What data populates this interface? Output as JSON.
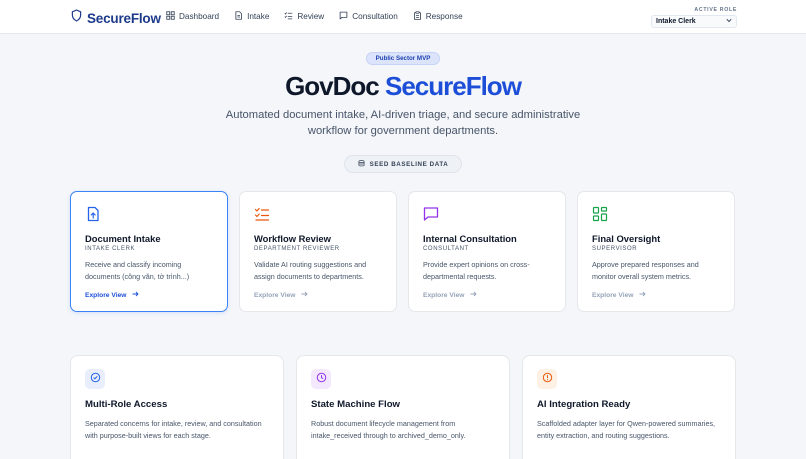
{
  "app": {
    "brand": "SecureFlow"
  },
  "nav": {
    "items": [
      {
        "label": "Dashboard",
        "icon": "dashboard-icon"
      },
      {
        "label": "Intake",
        "icon": "file-icon"
      },
      {
        "label": "Review",
        "icon": "list-check-icon"
      },
      {
        "label": "Consultation",
        "icon": "chat-icon"
      },
      {
        "label": "Response",
        "icon": "clipboard-icon"
      }
    ]
  },
  "role": {
    "caption": "ACTIVE ROLE",
    "selected": "Intake Clerk"
  },
  "hero": {
    "pill": "Public Sector MVP",
    "title_part1": "GovDoc",
    "title_part2": "SecureFlow",
    "subtitle": "Automated document intake, AI-driven triage, and secure administrative workflow for government departments.",
    "seed_button": "SEED BASELINE DATA"
  },
  "role_cards": [
    {
      "title": "Document Intake",
      "role": "INTAKE CLERK",
      "description": "Receive and classify incoming documents (công văn, tờ trình...)",
      "link": "Explore View",
      "icon": "file-upload-icon",
      "color": "#2563eb"
    },
    {
      "title": "Workflow Review",
      "role": "DEPARTMENT REVIEWER",
      "description": "Validate AI routing suggestions and assign documents to departments.",
      "link": "Explore View",
      "icon": "list-check-icon",
      "color": "#ea580c"
    },
    {
      "title": "Internal Consultation",
      "role": "CONSULTANT",
      "description": "Provide expert opinions on cross-departmental requests.",
      "link": "Explore View",
      "icon": "chat-icon",
      "color": "#9333ea"
    },
    {
      "title": "Final Oversight",
      "role": "SUPERVISOR",
      "description": "Approve prepared responses and monitor overall system metrics.",
      "link": "Explore View",
      "icon": "grid-icon",
      "color": "#16a34a"
    }
  ],
  "features": [
    {
      "title": "Multi-Role Access",
      "description": "Separated concerns for intake, review, and consultation with purpose-built views for each stage.",
      "icon": "check-circle-icon",
      "color": "#2563eb",
      "bg": "#e8eefc"
    },
    {
      "title": "State Machine Flow",
      "description": "Robust document lifecycle management from intake_received through to archived_demo_only.",
      "icon": "clock-icon",
      "color": "#9333ea",
      "bg": "#f3e8fd"
    },
    {
      "title": "AI Integration Ready",
      "description": "Scaffolded adapter layer for Qwen-powered summaries, entity extraction, and routing suggestions.",
      "icon": "alert-circle-icon",
      "color": "#ea580c",
      "bg": "#fdf0e4"
    }
  ]
}
